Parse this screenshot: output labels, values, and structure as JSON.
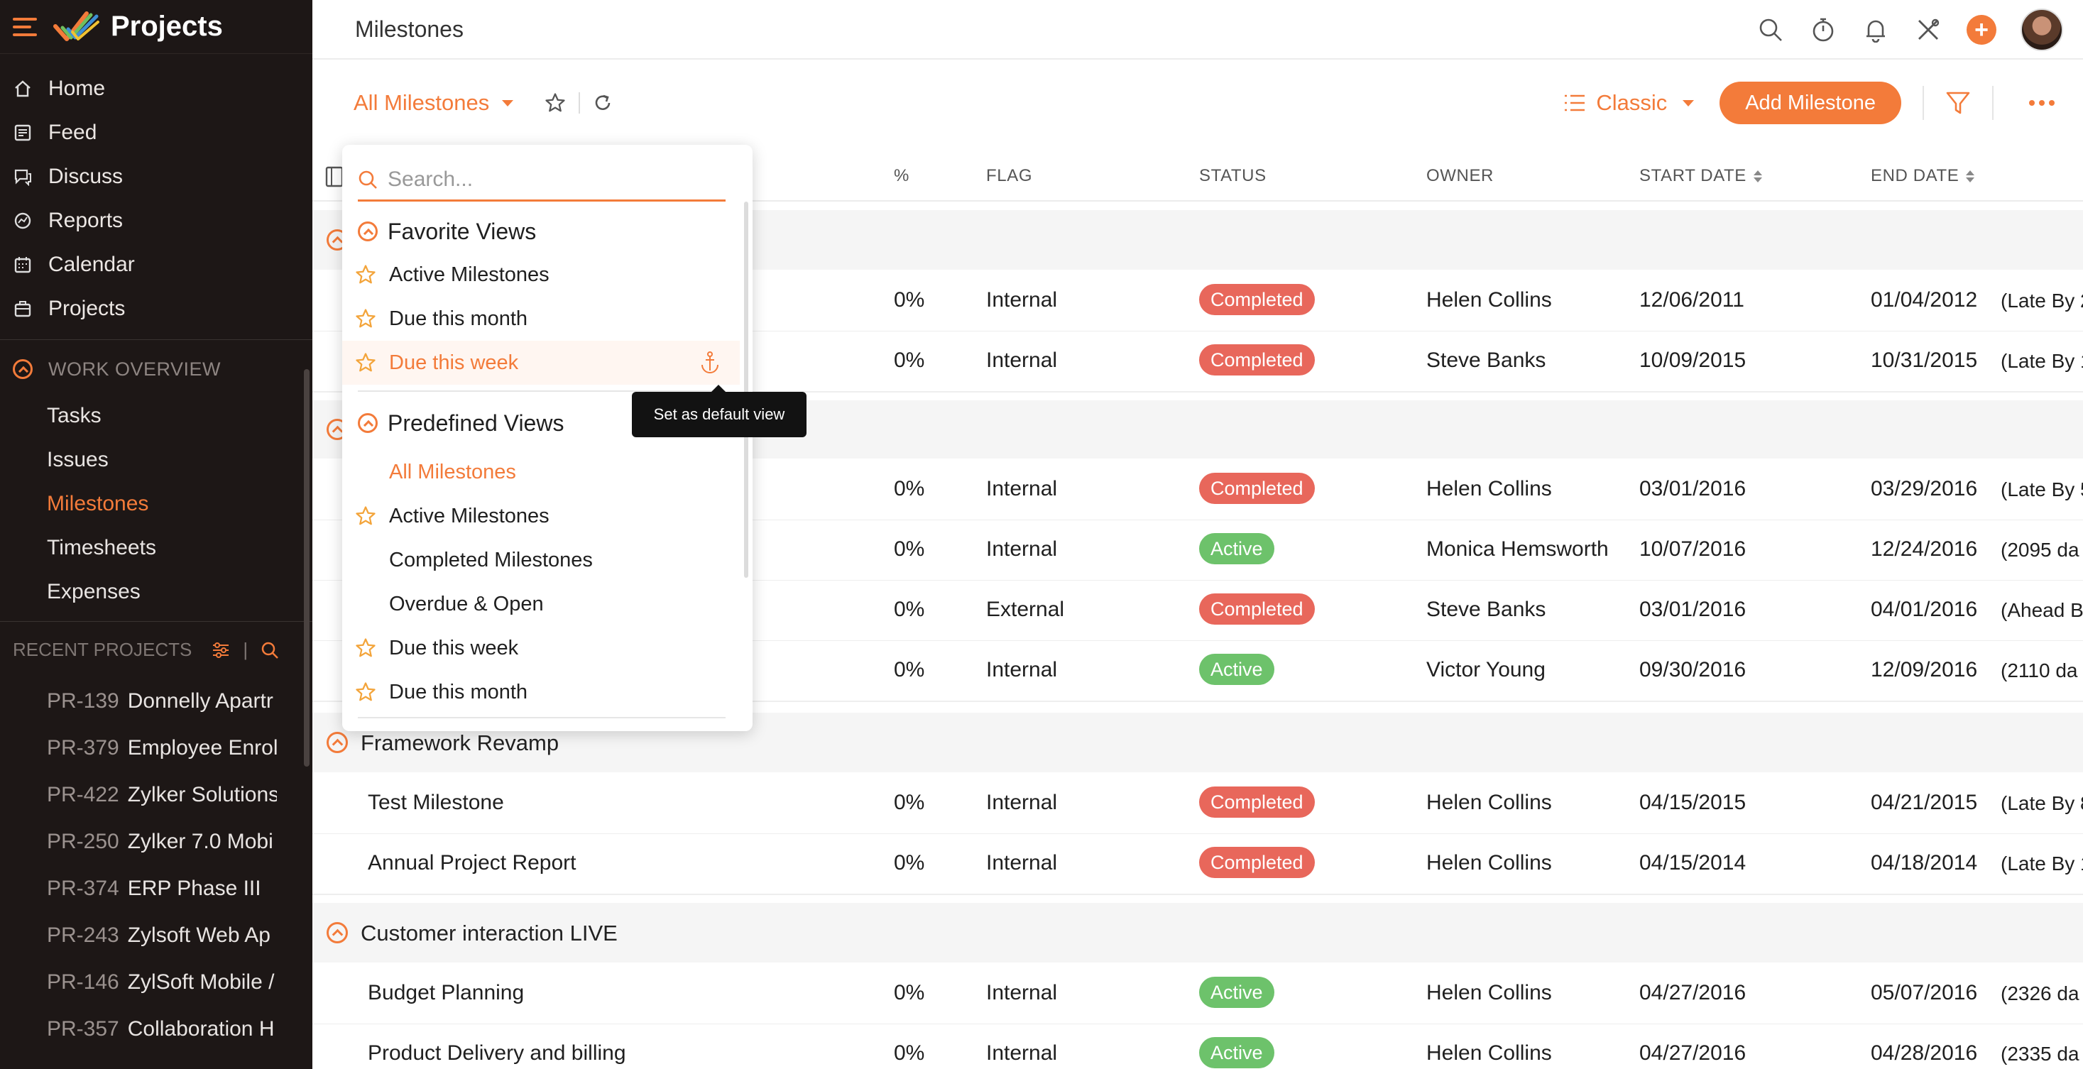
{
  "app": {
    "title": "Projects",
    "accent_color": "#f37b3a",
    "sidebar_bg": "#1d1716"
  },
  "sidebar": {
    "nav": [
      {
        "label": "Home",
        "icon": "home-icon"
      },
      {
        "label": "Feed",
        "icon": "feed-icon"
      },
      {
        "label": "Discuss",
        "icon": "discuss-icon"
      },
      {
        "label": "Reports",
        "icon": "reports-icon"
      },
      {
        "label": "Calendar",
        "icon": "calendar-icon"
      },
      {
        "label": "Projects",
        "icon": "projects-icon"
      }
    ],
    "work_overview": {
      "title": "WORK OVERVIEW",
      "items": [
        "Tasks",
        "Issues",
        "Milestones",
        "Timesheets",
        "Expenses"
      ],
      "active": "Milestones"
    },
    "recent_projects": {
      "title": "RECENT PROJECTS",
      "items": [
        {
          "id": "PR-139",
          "name": "Donnelly Apartr"
        },
        {
          "id": "PR-379",
          "name": "Employee Enrol"
        },
        {
          "id": "PR-422",
          "name": "Zylker Solutions"
        },
        {
          "id": "PR-250",
          "name": "Zylker 7.0 Mobi"
        },
        {
          "id": "PR-374",
          "name": "ERP Phase III"
        },
        {
          "id": "PR-243",
          "name": "Zylsoft Web Ap"
        },
        {
          "id": "PR-146",
          "name": "ZylSoft Mobile /"
        },
        {
          "id": "PR-357",
          "name": "Collaboration H"
        }
      ]
    }
  },
  "header": {
    "page_title": "Milestones",
    "icons": [
      "search-icon",
      "timer-icon",
      "bell-icon",
      "tools-icon",
      "plus-icon",
      "avatar"
    ]
  },
  "toolbar": {
    "view_label": "All Milestones",
    "layout_label": "Classic",
    "add_label": "Add Milestone"
  },
  "table": {
    "columns": {
      "percent": "%",
      "flag": "FLAG",
      "status": "STATUS",
      "owner": "OWNER",
      "start_date": "START DATE",
      "end_date": "END DATE"
    },
    "groups": [
      {
        "name": "",
        "rows": [
          {
            "name": "",
            "percent": "0%",
            "flag": "Internal",
            "status": "Completed",
            "owner": "Helen Collins",
            "start": "12/06/2011",
            "end": "01/04/2012",
            "note": "(Late By 2",
            "note_type": "late"
          },
          {
            "name": "",
            "percent": "0%",
            "flag": "Internal",
            "status": "Completed",
            "owner": "Steve Banks",
            "start": "10/09/2015",
            "end": "10/31/2015",
            "note": "(Late By 1",
            "note_type": "late"
          }
        ]
      },
      {
        "name": "",
        "rows": [
          {
            "name": "",
            "percent": "0%",
            "flag": "Internal",
            "status": "Completed",
            "owner": "Helen Collins",
            "start": "03/01/2016",
            "end": "03/29/2016",
            "note": "(Late By 5",
            "note_type": "late"
          },
          {
            "name": "",
            "percent": "0%",
            "flag": "Internal",
            "status": "Active",
            "owner": "Monica Hemsworth",
            "start": "10/07/2016",
            "end": "12/24/2016",
            "note": "(2095 da",
            "note_type": "late"
          },
          {
            "name": "",
            "percent": "0%",
            "flag": "External",
            "status": "Completed",
            "owner": "Steve Banks",
            "start": "03/01/2016",
            "end": "04/01/2016",
            "note": "(Ahead B",
            "note_type": "ahead"
          },
          {
            "name": "",
            "percent": "0%",
            "flag": "Internal",
            "status": "Active",
            "owner": "Victor Young",
            "start": "09/30/2016",
            "end": "12/09/2016",
            "note": "(2110 da",
            "note_type": "late"
          }
        ]
      },
      {
        "name": "Framework Revamp",
        "rows": [
          {
            "name": "Test Milestone",
            "percent": "0%",
            "flag": "Internal",
            "status": "Completed",
            "owner": "Helen Collins",
            "start": "04/15/2015",
            "end": "04/21/2015",
            "note": "(Late By 8",
            "note_type": "late"
          },
          {
            "name": "Annual Project Report",
            "percent": "0%",
            "flag": "Internal",
            "status": "Completed",
            "owner": "Helen Collins",
            "start": "04/15/2014",
            "end": "04/18/2014",
            "note": "(Late By 1",
            "note_type": "late"
          }
        ]
      },
      {
        "name": "Customer interaction LIVE",
        "rows": [
          {
            "name": "Budget Planning",
            "percent": "0%",
            "flag": "Internal",
            "status": "Active",
            "owner": "Helen Collins",
            "start": "04/27/2016",
            "end": "05/07/2016",
            "note": "(2326 da",
            "note_type": "late"
          },
          {
            "name": "Product Delivery and billing",
            "percent": "0%",
            "flag": "Internal",
            "status": "Active",
            "owner": "Helen Collins",
            "start": "04/27/2016",
            "end": "04/28/2016",
            "note": "(2335 da",
            "note_type": "late"
          }
        ]
      }
    ]
  },
  "dropdown": {
    "search_placeholder": "Search...",
    "favorite_title": "Favorite Views",
    "favorites": [
      "Active Milestones",
      "Due this month",
      "Due this week"
    ],
    "predefined_title": "Predefined Views",
    "predefined": [
      {
        "label": "All Milestones",
        "star": false,
        "selected": true
      },
      {
        "label": "Active Milestones",
        "star": true,
        "selected": false
      },
      {
        "label": "Completed Milestones",
        "star": false,
        "selected": false
      },
      {
        "label": "Overdue & Open",
        "star": false,
        "selected": false
      },
      {
        "label": "Due this week",
        "star": true,
        "selected": false
      },
      {
        "label": "Due this month",
        "star": true,
        "selected": false
      }
    ],
    "tooltip": "Set as default view"
  }
}
